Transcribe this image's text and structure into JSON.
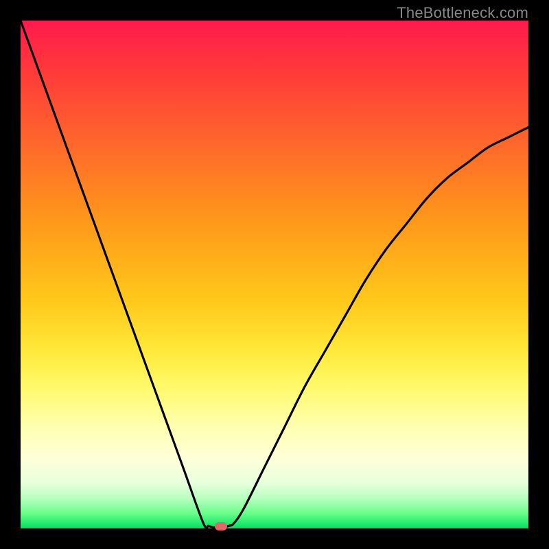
{
  "watermark": "TheBottleneck.com",
  "colors": {
    "frame": "#000000",
    "gradient_top": "#ff1a4d",
    "gradient_bottom": "#00e060",
    "curve": "#000000",
    "marker": "#d86a6a",
    "watermark": "#888888"
  },
  "chart_data": {
    "type": "line",
    "title": "",
    "xlabel": "",
    "ylabel": "",
    "xlim": [
      0,
      100
    ],
    "ylim": [
      0,
      100
    ],
    "x": [
      0,
      4,
      8,
      12,
      16,
      20,
      24,
      28,
      32,
      36,
      37,
      38,
      39,
      40,
      41,
      42,
      44,
      48,
      52,
      56,
      60,
      64,
      68,
      72,
      76,
      80,
      84,
      88,
      92,
      96,
      100
    ],
    "values": [
      100,
      89,
      78,
      67,
      56,
      45,
      34,
      23,
      12,
      1,
      0.5,
      0.2,
      0.2,
      0.2,
      0.5,
      1,
      4,
      12,
      20,
      28,
      35,
      42,
      49,
      55,
      60,
      65,
      69,
      72,
      75,
      77,
      79
    ],
    "minimum_x": 39,
    "minimum_y": 0,
    "marker": {
      "x": 39.5,
      "y": 0
    },
    "color_scale_meaning": "vertical gradient: top=high bottleneck (red), bottom=low bottleneck (green)"
  }
}
